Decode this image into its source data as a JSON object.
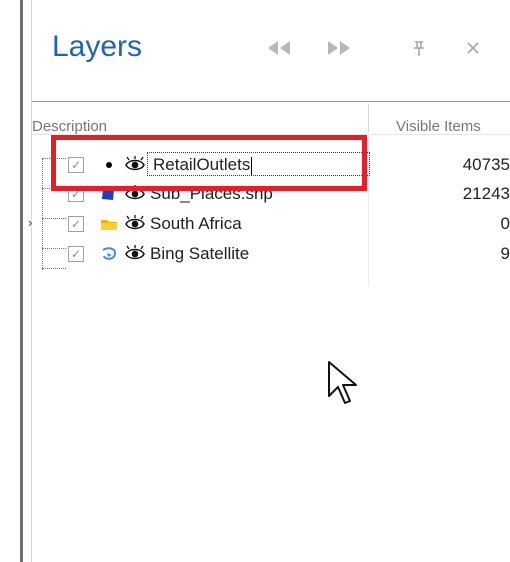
{
  "panel": {
    "title": "Layers",
    "buttons": {
      "previous_icon": "double-chevron-left",
      "next_icon": "double-chevron-right",
      "pin_icon": "pin",
      "close_icon": "close"
    }
  },
  "grid": {
    "columns": {
      "description": "Description",
      "visible_items": "Visible Items"
    },
    "rows": [
      {
        "label": "RetailOutlets",
        "visible_items": "40735",
        "editing": true
      },
      {
        "label": "Sub_Places.shp",
        "visible_items": "21243",
        "editing": false
      },
      {
        "label": "South Africa",
        "visible_items": "0",
        "editing": false
      },
      {
        "label": "Bing Satellite",
        "visible_items": "9",
        "editing": false
      }
    ]
  },
  "colors": {
    "title": "#1f63b8",
    "highlight": "#e51f28",
    "folder": "#f0b400",
    "shape": "#1d3fc3",
    "satellite": "#3a93d5"
  }
}
